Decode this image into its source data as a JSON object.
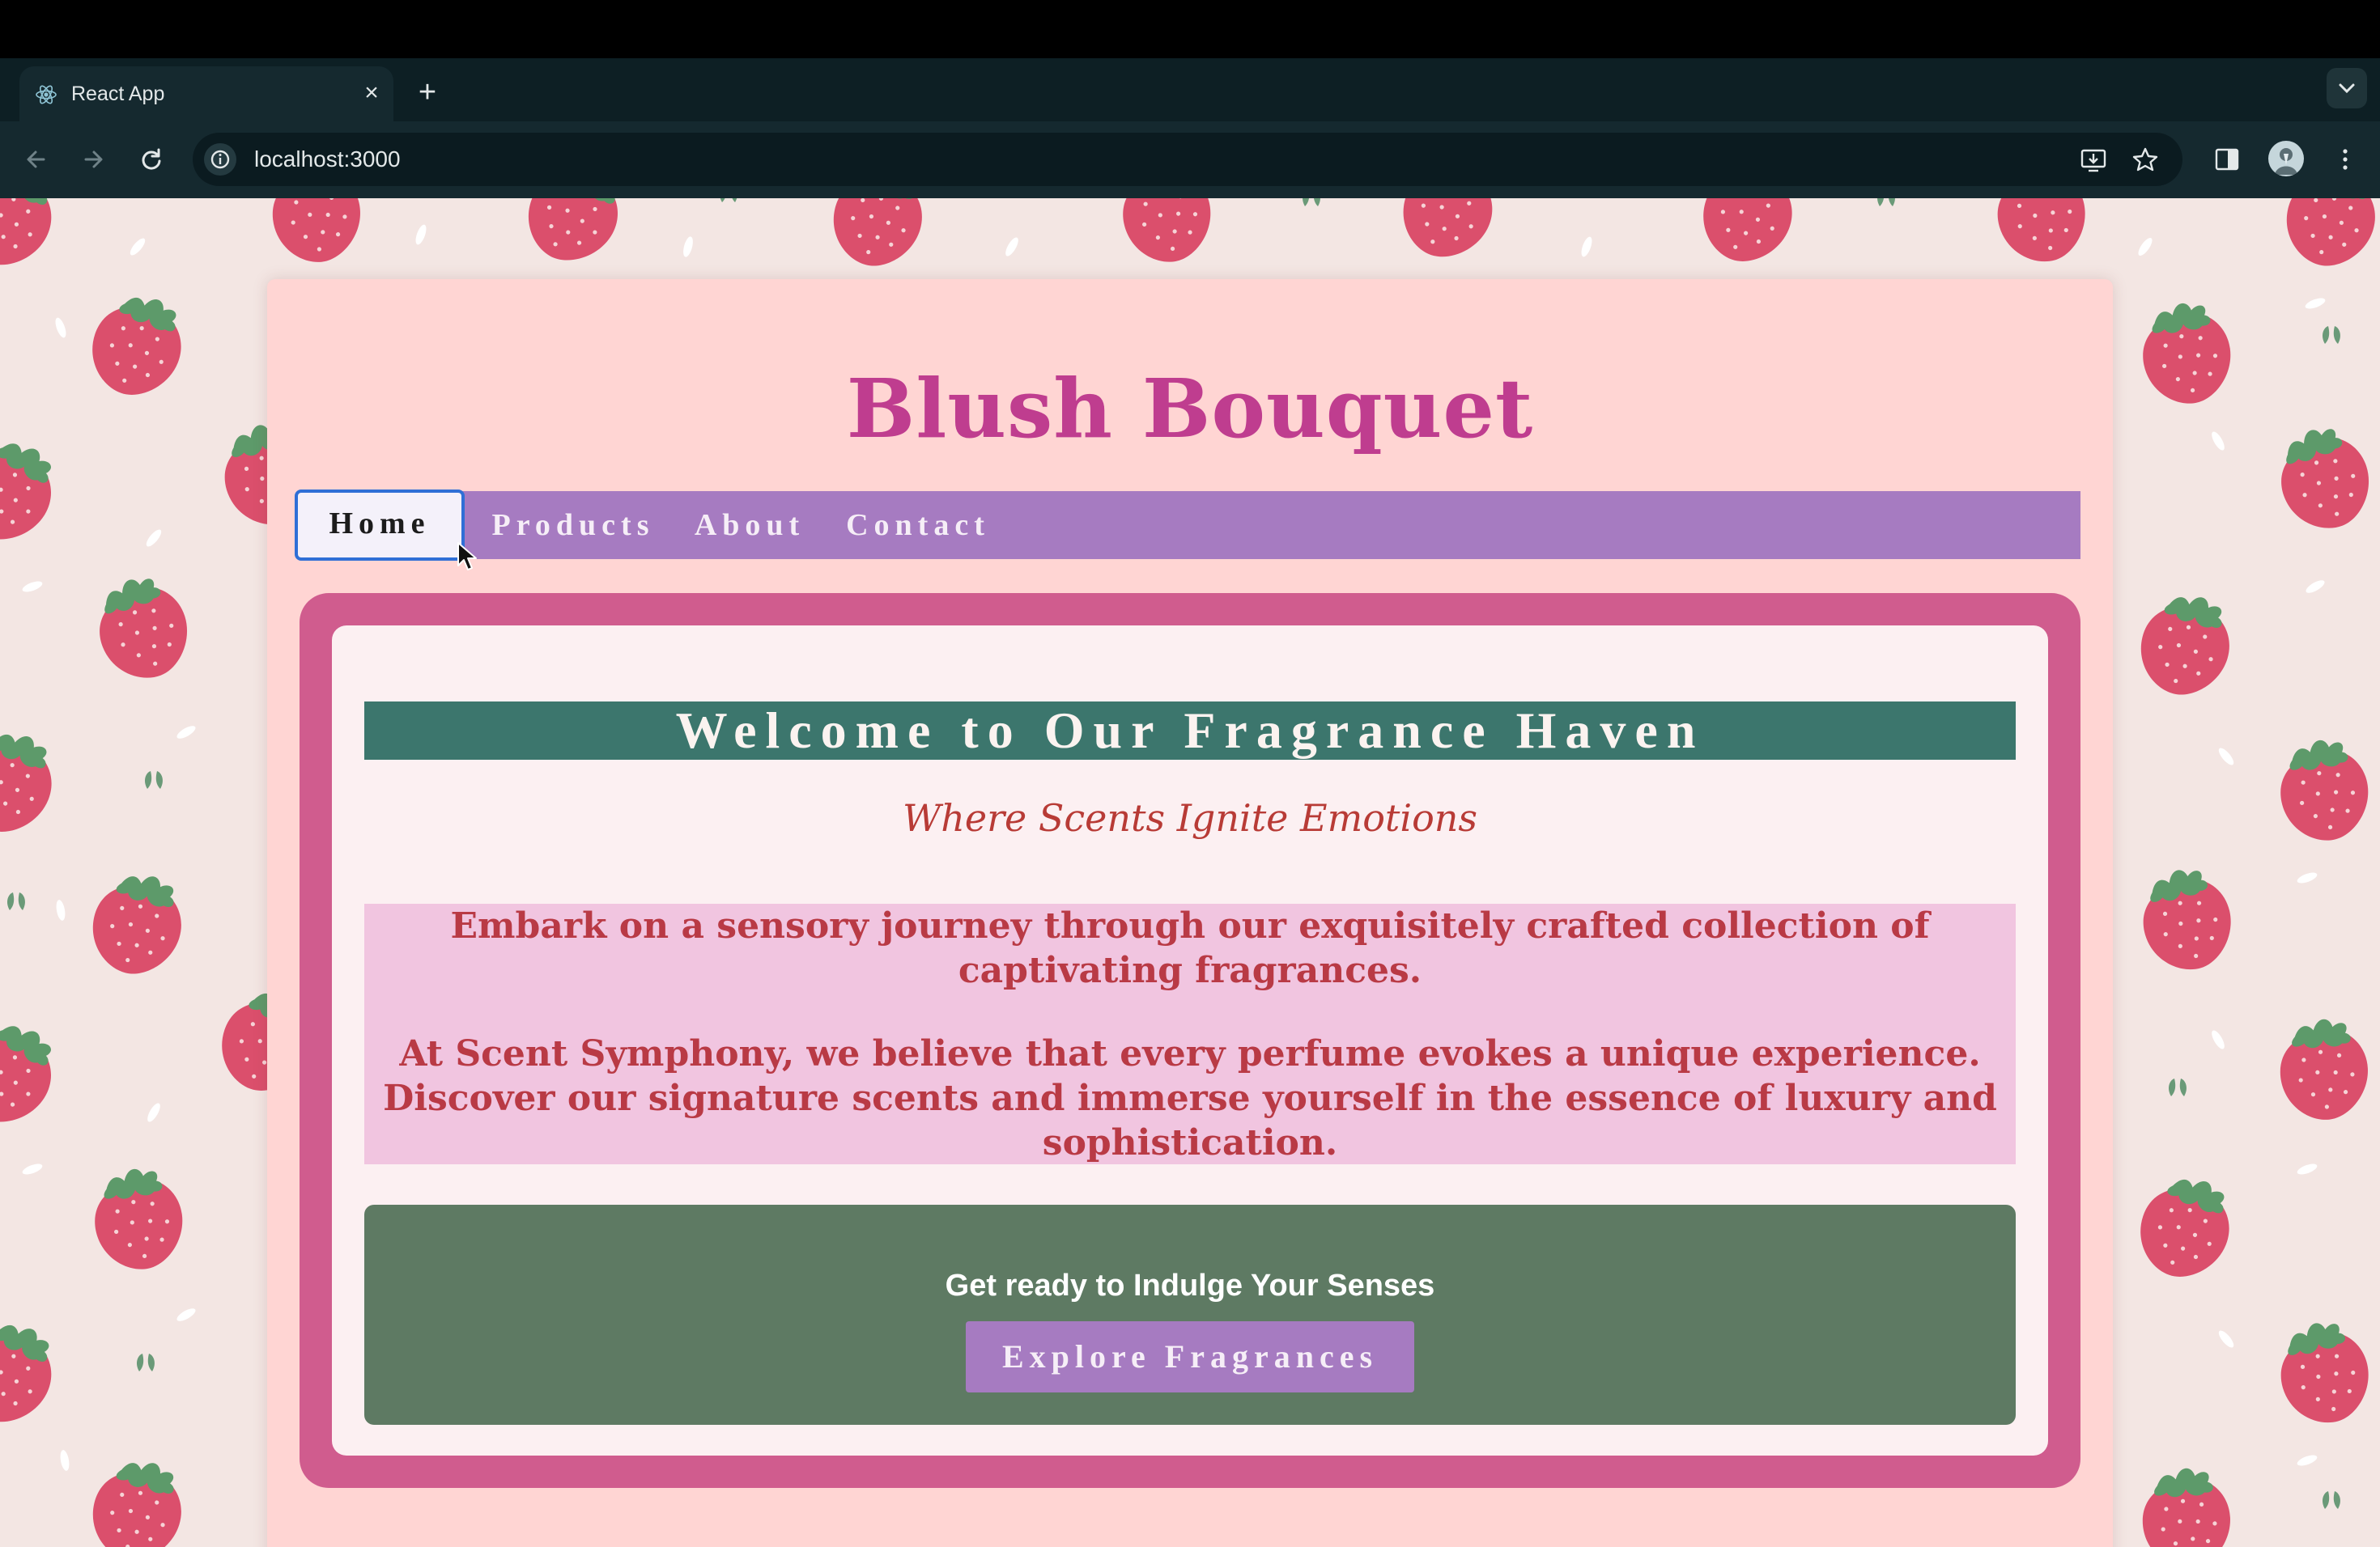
{
  "browser": {
    "tab_title": "React App",
    "url": "localhost:3000",
    "icons": [
      "react-favicon",
      "close-icon",
      "plus-icon",
      "chevron-down-icon",
      "back-arrow-icon",
      "forward-arrow-icon",
      "reload-icon",
      "site-info-icon",
      "install-app-icon",
      "bookmark-star-icon",
      "side-panel-icon",
      "profile-avatar",
      "kebab-menu-icon"
    ]
  },
  "site": {
    "title": "Blush Bouquet",
    "nav": {
      "items": [
        {
          "label": "Home",
          "active": true
        },
        {
          "label": "Products",
          "active": false
        },
        {
          "label": "About",
          "active": false
        },
        {
          "label": "Contact",
          "active": false
        }
      ]
    },
    "welcome": {
      "heading": "Welcome to Our Fragrance Haven",
      "tagline": "Where Scents Ignite Emotions",
      "paragraph1": "Embark on a sensory journey through our exquisitely crafted collection of captivating fragrances.",
      "paragraph2": "At Scent Symphony, we believe that every perfume evokes a unique experience. Discover our signature scents and immerse yourself in the essence of luxury and sophistication."
    },
    "cta": {
      "heading": "Get ready to Indulge Your Senses",
      "button_label": "Explore Fragrances"
    }
  },
  "colors": {
    "page_background": "#f3e6e3",
    "card_background": "#ffd5d3",
    "title": "#bf3d8f",
    "nav_bar": "#a67bc1",
    "frame": "#d05c8e",
    "banner": "#3c766d",
    "accent_text": "#b93a45",
    "intro_box": "#f1c5e0",
    "cta_panel": "#5e7a63",
    "strawberry": "#db4f6c"
  }
}
